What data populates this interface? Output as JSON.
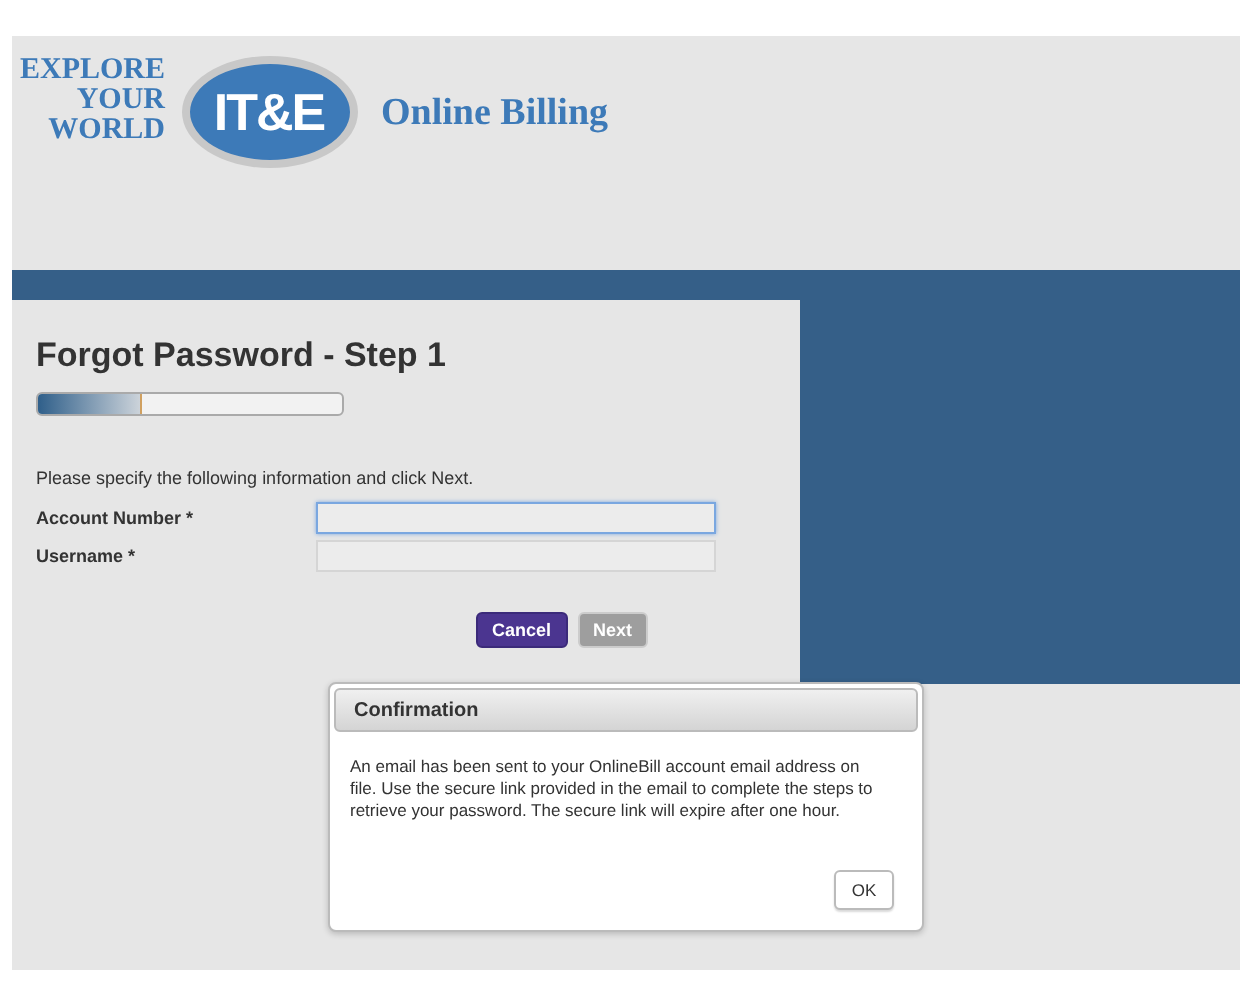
{
  "header": {
    "tagline": [
      "EXPLORE",
      "YOUR",
      "WORLD"
    ],
    "logo": "IT&E",
    "title": "Online Billing"
  },
  "form": {
    "title": "Forgot Password - Step 1",
    "progress": {
      "level": 0.34
    },
    "instructions": "Please specify the following information and click Next.",
    "fields": [
      {
        "label": "Account Number",
        "required_mark": "*",
        "focused": true
      },
      {
        "label": "Username",
        "required_mark": "*",
        "focused": false
      }
    ],
    "buttons": [
      {
        "label": "Cancel",
        "disabled": false
      },
      {
        "label": "Next",
        "disabled": true
      }
    ]
  },
  "dialog": {
    "title": "Confirmation",
    "message": "An email has been sent to your OnlineBill account email address on file. Use the secure link provided in the email to complete the steps to retrieve your password. The secure link will expire after one hour.",
    "button": "OK"
  }
}
